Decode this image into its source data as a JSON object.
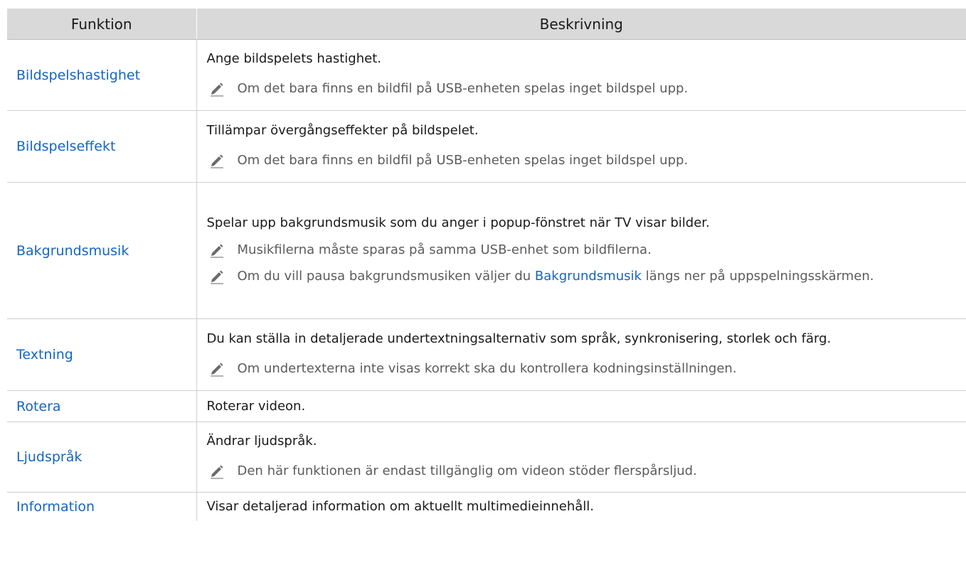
{
  "header": {
    "col1": "Funktion",
    "col2": "Beskrivning"
  },
  "rows": [
    {
      "name": "Bildspelshastighet",
      "text": "Ange bildspelets hastighet.",
      "notes": [
        "Om det bara finns en bildfil på USB-enheten spelas inget bildspel upp."
      ]
    },
    {
      "name": "Bildspelseffekt",
      "text": "Tillämpar övergångseffekter på bildspelet.",
      "notes": [
        "Om det bara finns en bildfil på USB-enheten spelas inget bildspel upp."
      ]
    },
    {
      "name": "Bakgrundsmusik",
      "text": "Spelar upp bakgrundsmusik som du anger i popup-fönstret när TV visar bilder.",
      "notes": [
        "Musikfilerna måste sparas på samma USB-enhet som bildfilerna.",
        {
          "before": "Om du vill pausa bakgrundsmusiken väljer du ",
          "highlight": "Bakgrundsmusik",
          "after": " längs ner på uppspelningsskärmen."
        }
      ]
    },
    {
      "name": "Textning",
      "text": "Du kan ställa in detaljerade undertextningsalternativ som språk, synkronisering, storlek och färg.",
      "notes": [
        "Om undertexterna inte visas korrekt ska du kontrollera kodningsinställningen."
      ]
    },
    {
      "name": "Rotera",
      "text": "Roterar videon.",
      "notes": []
    },
    {
      "name": "Ljudspråk",
      "text": "Ändrar ljudspråk.",
      "notes": [
        "Den här funktionen är endast tillgänglig om videon stöder flerspårsljud."
      ]
    },
    {
      "name": "Information",
      "text": "Visar detaljerad information om aktuellt multimedieinnehåll.",
      "notes": []
    }
  ],
  "icons": {
    "note": "pencil-note-icon"
  },
  "colors": {
    "header_bg": "#d9d9d9",
    "link_blue": "#1565c0",
    "note_gray": "#5c5c5c"
  }
}
